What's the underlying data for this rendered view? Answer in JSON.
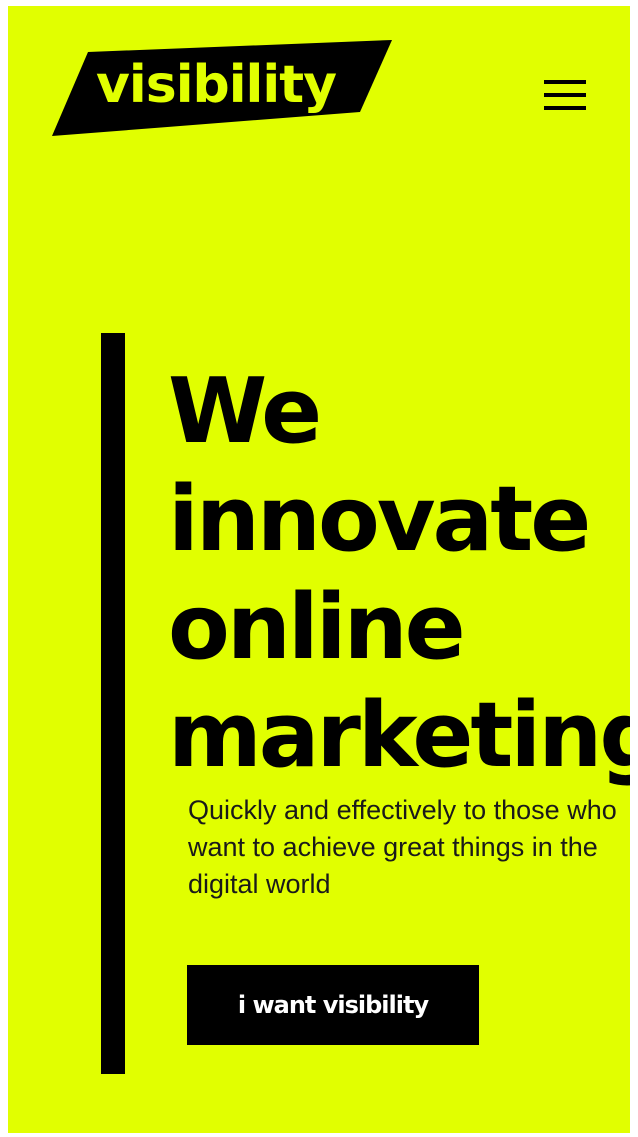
{
  "brand": {
    "logo_text": "visibility",
    "accent_color": "#e1ff00",
    "ink_color": "#000000"
  },
  "header": {
    "menu_icon": "hamburger-menu-icon"
  },
  "hero": {
    "headline_lines": [
      "We",
      "innovate",
      "online",
      "marketing"
    ],
    "subtitle": "Quickly and effectively to those who want to achieve great things in the digital world",
    "cta_label": "i want visibility"
  }
}
